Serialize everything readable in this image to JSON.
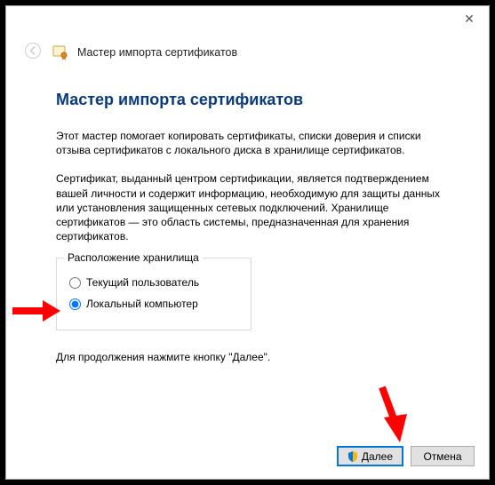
{
  "header": {
    "window_title": "Мастер импорта сертификатов"
  },
  "page": {
    "title": "Мастер импорта сертификатов",
    "intro": "Этот мастер помогает копировать сертификаты, списки доверия и списки отзыва сертификатов с локального диска в хранилище сертификатов.",
    "desc": "Сертификат, выданный центром сертификации, является подтверждением вашей личности и содержит информацию, необходимую для защиты данных или установления защищенных сетевых подключений. Хранилище сертификатов — это область системы, предназначенная для хранения сертификатов.",
    "group_legend": "Расположение хранилища",
    "radio_current_user": "Текущий пользователь",
    "radio_local_computer": "Локальный компьютер",
    "continue_hint": "Для продолжения нажмите кнопку \"Далее\"."
  },
  "footer": {
    "next": "Далее",
    "cancel": "Отмена"
  }
}
